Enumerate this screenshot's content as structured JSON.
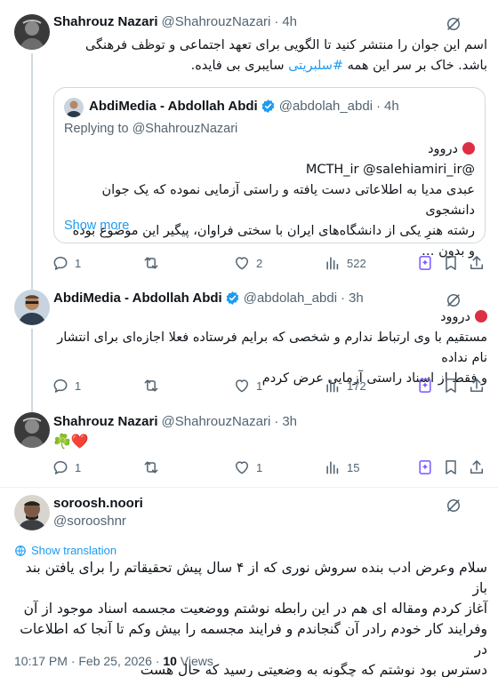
{
  "tweets": [
    {
      "name": "Shahrouz Nazari",
      "handle": "@ShahrouzNazari",
      "time": "4h",
      "text_before": "اسم این جوان را منتشر کنید تا الگویی برای تعهد اجتماعی و توظف فرهنگی باشد. خاک بر سر این همه ",
      "hashtag": "#سلبریتی",
      "text_after": " سایبری بی فایده.",
      "quote": {
        "name": "AbdiMedia - Abdollah Abdi",
        "handle": "@abdolah_abdi",
        "time": "4h",
        "replying": "Replying to @ShahrouzNazari",
        "line1": "دروود",
        "line2": "@MCTH_ir @salehiamiri_ir",
        "line3": "عبدی مدیا به اطلاعاتی دست یافته و راستی آزمایی نموده که یک جوان دانشجوی",
        "line4": "رشته هنرِ یکی از دانشگاه‌های ایران با سختی فراوان، پیگیر این موضوع بوده و بدون …",
        "show_more": "Show more"
      },
      "replies": "1",
      "reposts": "",
      "likes": "2",
      "views": "522"
    },
    {
      "name": "AbdiMedia - Abdollah Abdi",
      "handle": "@abdolah_abdi",
      "time": "3h",
      "line1": "دروود",
      "line2": "مستقیم با وی ارتباط ندارم و شخصی که برایم فرستاده فعلا اجازه‌ای برای انتشار نام نداده",
      "line3": "و فقط از اسناد راستی آزمایی عرض کردم",
      "replies": "1",
      "reposts": "",
      "likes": "1",
      "views": "172"
    },
    {
      "name": "Shahrouz Nazari",
      "handle": "@ShahrouzNazari",
      "time": "3h",
      "emoji": "☘️❤️",
      "replies": "1",
      "reposts": "",
      "likes": "1",
      "views": "15"
    }
  ],
  "main": {
    "name": "soroosh.noori",
    "handle": "@sorooshnr",
    "translate": "Show translation",
    "lines": [
      "سلام وعرض ادب بنده سروش نوری که از ۴ سال پیش تحقیقاتم را برای یافتن بند باز",
      "آغاز کردم ومقاله ای هم در این رابطه نوشتم ووضعیت مجسمه اسناد موجود از آن",
      "وفرایند کار خودم رادر آن گنجاندم و فرایند مجسمه را بیش وکم تا آنجا که اطلاعات در",
      "دسترس بود نوشتم که چگونه به وضعیتی رسید که حال هست"
    ],
    "timestamp": "10:17 PM · Feb 25, 2026 · ",
    "views_count": "10",
    "views_label": " Views"
  },
  "colors": {
    "accent": "#1d9bf0",
    "muted": "#536471",
    "text": "#0f1419",
    "border": "#cfd9de",
    "heart": "#e0245e",
    "clover": "#2e9e3c"
  },
  "icons": [
    "grok-icon",
    "verified-badge-icon",
    "reply-icon",
    "repost-icon",
    "like-icon",
    "views-icon",
    "grok-explain-icon",
    "bookmark-icon",
    "share-icon",
    "globe-icon",
    "red-circle-icon"
  ]
}
